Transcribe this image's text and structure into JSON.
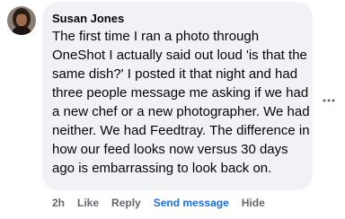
{
  "comment": {
    "author": "Susan Jones",
    "text": "The first time I ran a photo through OneShot I actually said out loud 'is that the same dish?' I posted it that night and had three people message me asking if we had a new chef or a new photographer. We had neither. We had Feedtray. The difference in how our feed looks now versus 30 days ago is embarrassing to look back on.",
    "avatar_icon": "user-avatar-photo",
    "more_icon": "more-horizontal-icon"
  },
  "actions": {
    "timestamp": "2h",
    "like": "Like",
    "reply": "Reply",
    "send_message": "Send message",
    "hide": "Hide"
  },
  "colors": {
    "bubble": "#f0f2f5",
    "text": "#050505",
    "secondary": "#65676b",
    "link": "#216fdb"
  }
}
